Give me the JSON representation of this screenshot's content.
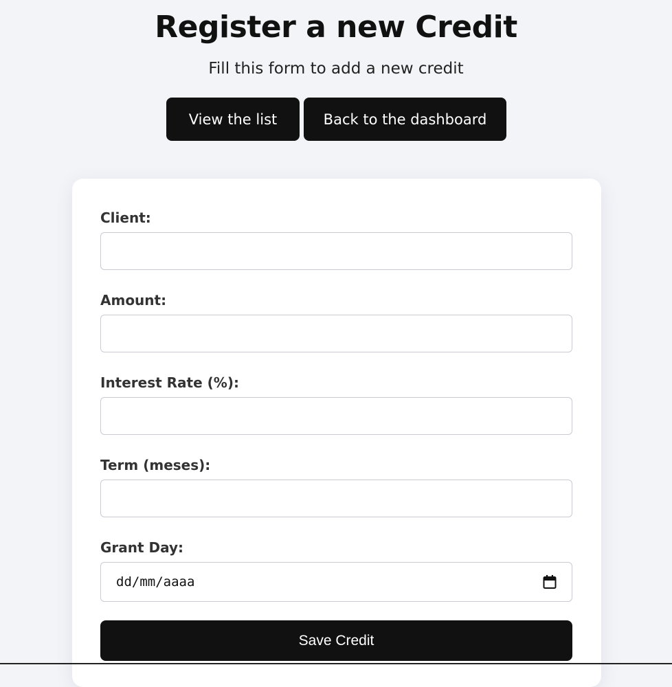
{
  "header": {
    "title": "Register a new Credit",
    "subtitle": "Fill this form to add a new credit"
  },
  "nav": {
    "view_list_label": "View the list",
    "dashboard_label": "Back to the dashboard"
  },
  "form": {
    "fields": [
      {
        "label": "Client:",
        "value": ""
      },
      {
        "label": "Amount:",
        "value": ""
      },
      {
        "label": "Interest Rate (%):",
        "value": ""
      },
      {
        "label": "Term (meses):",
        "value": ""
      },
      {
        "label": "Grant Day:",
        "placeholder": "dd/mm/aaaa",
        "icon": "calendar-icon"
      }
    ],
    "submit_label": "Save Credit"
  },
  "colors": {
    "background": "#f3f4f8",
    "button": "#111111",
    "card": "#ffffff"
  }
}
